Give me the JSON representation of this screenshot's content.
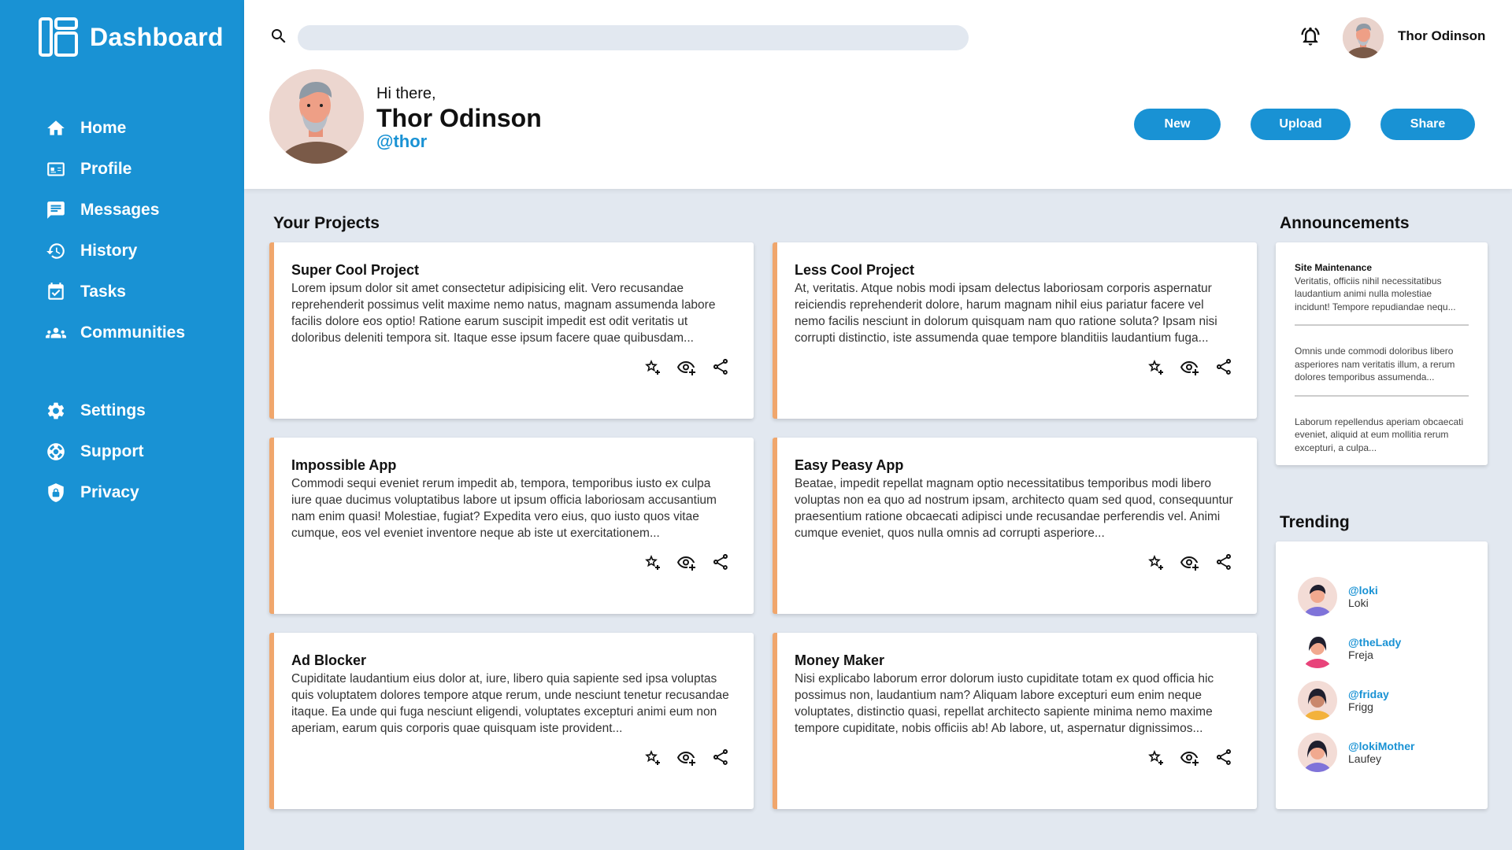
{
  "app": {
    "title": "Dashboard"
  },
  "sidebar": {
    "main_items": [
      {
        "label": "Home",
        "icon": "home-icon"
      },
      {
        "label": "Profile",
        "icon": "profile-card-icon"
      },
      {
        "label": "Messages",
        "icon": "message-icon"
      },
      {
        "label": "History",
        "icon": "history-icon"
      },
      {
        "label": "Tasks",
        "icon": "tasks-icon"
      },
      {
        "label": "Communities",
        "icon": "group-icon"
      }
    ],
    "secondary_items": [
      {
        "label": "Settings",
        "icon": "gear-icon"
      },
      {
        "label": "Support",
        "icon": "lifebuoy-icon"
      },
      {
        "label": "Privacy",
        "icon": "shield-icon"
      }
    ]
  },
  "header": {
    "search_placeholder": "",
    "user_name": "Thor Odinson",
    "greeting": "Hi there,",
    "display_name": "Thor Odinson",
    "handle": "@thor",
    "buttons": {
      "new": "New",
      "upload": "Upload",
      "share": "Share"
    }
  },
  "projects": {
    "title": "Your Projects",
    "items": [
      {
        "title": "Super Cool Project",
        "description": "Lorem ipsum dolor sit amet consectetur adipisicing elit. Vero recusandae reprehenderit possimus velit maxime nemo natus, magnam assumenda labore facilis dolore eos optio! Ratione earum suscipit impedit est odit veritatis ut doloribus deleniti tempora sit. Itaque esse ipsum facere quae quibusdam..."
      },
      {
        "title": "Less Cool Project",
        "description": "At, veritatis. Atque nobis modi ipsam delectus laboriosam corporis aspernatur reiciendis reprehenderit dolore, harum magnam nihil eius pariatur facere vel nemo facilis nesciunt in dolorum quisquam nam quo ratione soluta? Ipsam nisi corrupti distinctio, iste assumenda quae tempore blanditiis laudantium fuga..."
      },
      {
        "title": "Impossible App",
        "description": "Commodi sequi eveniet rerum impedit ab, tempora, temporibus iusto ex culpa iure quae ducimus voluptatibus labore ut ipsum officia laboriosam accusantium nam enim quasi! Molestiae, fugiat? Expedita vero eius, quo iusto quos vitae cumque, eos vel eveniet inventore neque ab iste ut exercitationem..."
      },
      {
        "title": "Easy Peasy App",
        "description": "Beatae, impedit repellat magnam optio necessitatibus temporibus modi libero voluptas non ea quo ad nostrum ipsam, architecto quam sed quod, consequuntur praesentium ratione obcaecati adipisci unde recusandae perferendis vel. Animi cumque eveniet, quos nulla omnis ad corrupti asperiore..."
      },
      {
        "title": "Ad Blocker",
        "description": "Cupiditate laudantium eius dolor at, iure, libero quia sapiente sed ipsa voluptas quis voluptatem dolores tempore atque rerum, unde nesciunt tenetur recusandae itaque. Ea unde qui fuga nesciunt eligendi, voluptates excepturi animi eum non aperiam, earum quis corporis quae quisquam iste provident..."
      },
      {
        "title": "Money Maker",
        "description": "Nisi explicabo laborum error dolorum iusto cupiditate totam ex quod officia hic possimus non, laudantium nam? Aliquam labore excepturi eum enim neque voluptates, distinctio quasi, repellat architecto sapiente minima nemo maxime tempore cupiditate, nobis officiis ab! Ab labore, ut, aspernatur dignissimos..."
      }
    ]
  },
  "announcements": {
    "title": "Announcements",
    "items": [
      {
        "heading": "Site Maintenance",
        "body": "Veritatis, officiis nihil necessitatibus laudantium animi nulla molestiae incidunt! Tempore repudiandae nequ..."
      },
      {
        "heading": "",
        "body": "Omnis unde commodi doloribus libero asperiores nam veritatis illum, a rerum dolores temporibus assumenda..."
      },
      {
        "heading": "",
        "body": "Laborum repellendus aperiam obcaecati eveniet, aliquid at eum mollitia rerum excepturi, a culpa..."
      }
    ]
  },
  "trending": {
    "title": "Trending",
    "items": [
      {
        "handle": "@loki",
        "name": "Loki"
      },
      {
        "handle": "@theLady",
        "name": "Freja"
      },
      {
        "handle": "@friday",
        "name": "Frigg"
      },
      {
        "handle": "@lokiMother",
        "name": "Laufey"
      }
    ]
  },
  "colors": {
    "primary": "#1992d4",
    "accent": "#f0a66c",
    "background": "#e2e8f0"
  }
}
